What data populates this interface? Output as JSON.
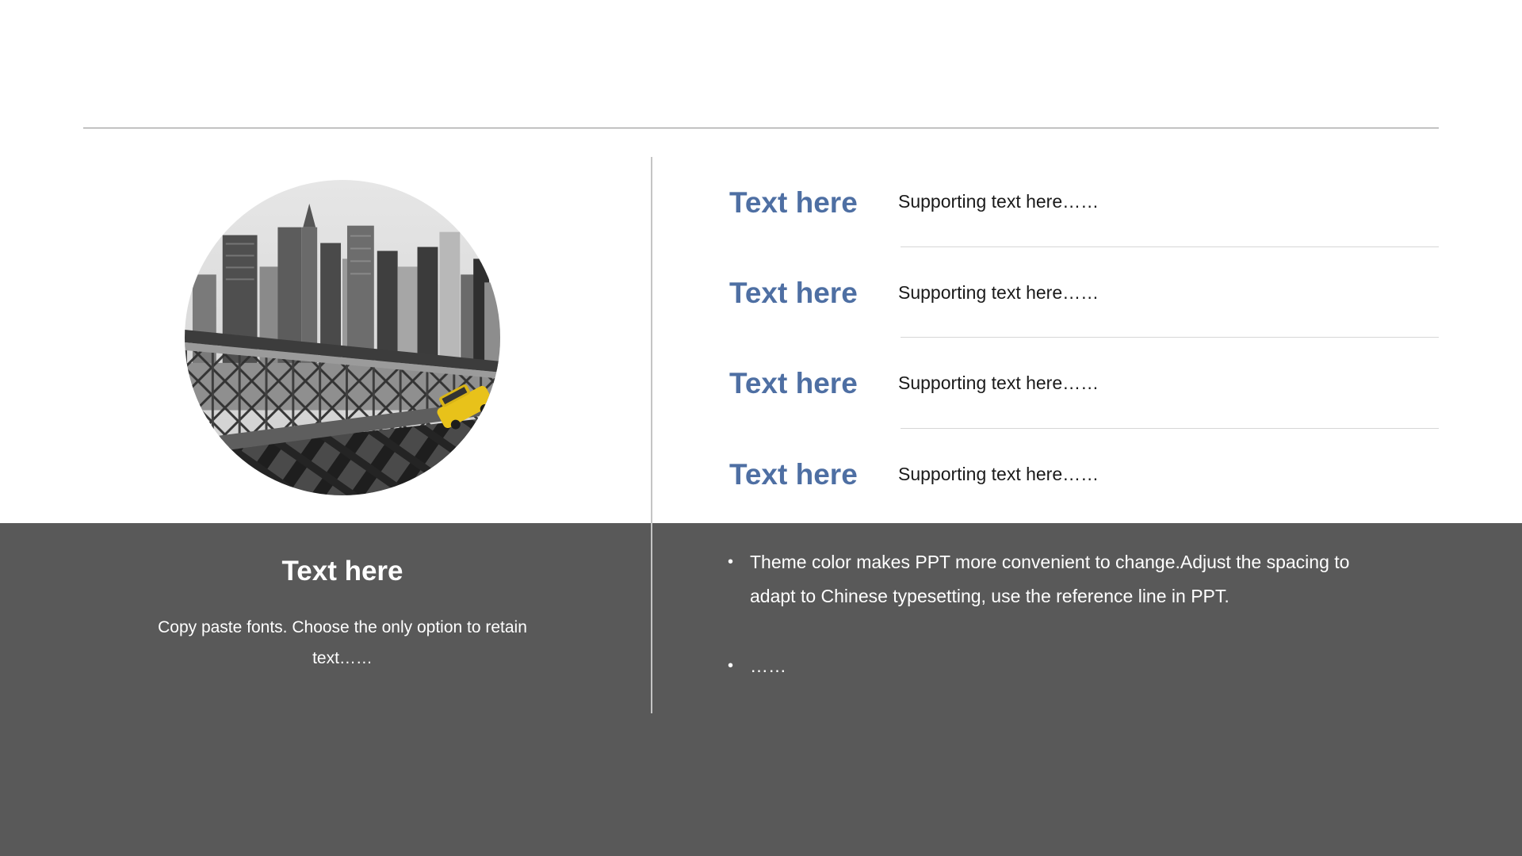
{
  "items": [
    {
      "title": "Text here",
      "text": "Supporting text here……"
    },
    {
      "title": "Text here",
      "text": "Supporting text here……"
    },
    {
      "title": "Text here",
      "text": "Supporting text here……"
    },
    {
      "title": "Text here",
      "text": "Supporting text here……"
    }
  ],
  "left_panel": {
    "title": "Text here",
    "body": "Copy paste fonts. Choose the only option to retain text……"
  },
  "bullets": [
    "Theme color makes PPT more convenient to change.Adjust the spacing to adapt to Chinese typesetting, use the reference line in PPT.",
    "……"
  ],
  "colors": {
    "accent": "#4e6fa3",
    "band": "#595959",
    "background": "#ffffff"
  },
  "icons": {
    "bullet": "•"
  }
}
